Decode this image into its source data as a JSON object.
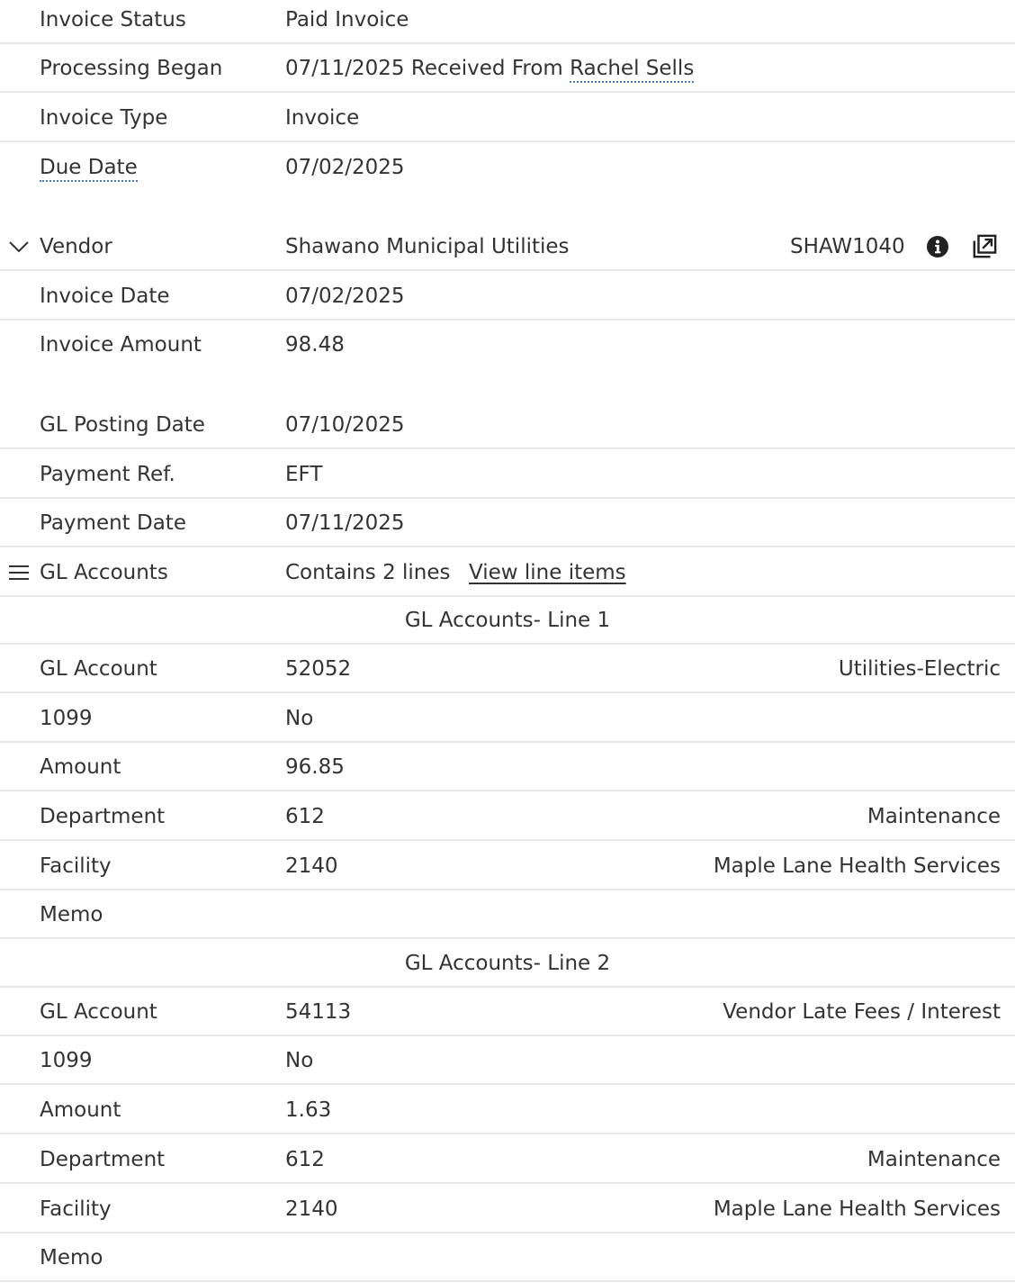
{
  "invoice": {
    "status_label": "Invoice Status",
    "status_value": "Paid Invoice",
    "processing_label": "Processing Began",
    "processing_prefix": "07/11/2025 Received From ",
    "processing_user": "Rachel Sells",
    "type_label": "Invoice Type",
    "type_value": "Invoice",
    "due_label": "Due Date",
    "due_value": "07/02/2025"
  },
  "vendor": {
    "label": "Vendor",
    "name": "Shawano Municipal Utilities",
    "code": "SHAW1040",
    "icons": [
      "chevron-down-icon",
      "info-icon",
      "open-in-new-window-icon"
    ]
  },
  "details": {
    "invoice_date_label": "Invoice Date",
    "invoice_date_value": "07/02/2025",
    "amount_label": "Invoice Amount",
    "amount_value": "98.48",
    "gl_posting_label": "GL Posting Date",
    "gl_posting_value": "07/10/2025",
    "payment_ref_label": "Payment Ref.",
    "payment_ref_value": "EFT",
    "payment_date_label": "Payment Date",
    "payment_date_value": "07/11/2025"
  },
  "gl_accounts": {
    "label": "GL Accounts",
    "summary": "Contains 2 lines",
    "view_link": "View line items",
    "icon": "hamburger-menu-icon"
  },
  "lines": [
    {
      "title": "GL Accounts- Line 1",
      "gl_account_label": "GL Account",
      "gl_account_value": "52052",
      "gl_account_desc": "Utilities-Electric",
      "f1099_label": "1099",
      "f1099_value": "No",
      "amount_label": "Amount",
      "amount_value": "96.85",
      "department_label": "Department",
      "department_value": "612",
      "department_desc": "Maintenance",
      "facility_label": "Facility",
      "facility_value": "2140",
      "facility_desc": "Maple Lane Health Services",
      "memo_label": "Memo"
    },
    {
      "title": "GL Accounts- Line 2",
      "gl_account_label": "GL Account",
      "gl_account_value": "54113",
      "gl_account_desc": "Vendor Late Fees / Interest",
      "f1099_label": "1099",
      "f1099_value": "No",
      "amount_label": "Amount",
      "amount_value": "1.63",
      "department_label": "Department",
      "department_value": "612",
      "department_desc": "Maintenance",
      "facility_label": "Facility",
      "facility_value": "2140",
      "facility_desc": "Maple Lane Health Services",
      "memo_label": "Memo"
    }
  ]
}
